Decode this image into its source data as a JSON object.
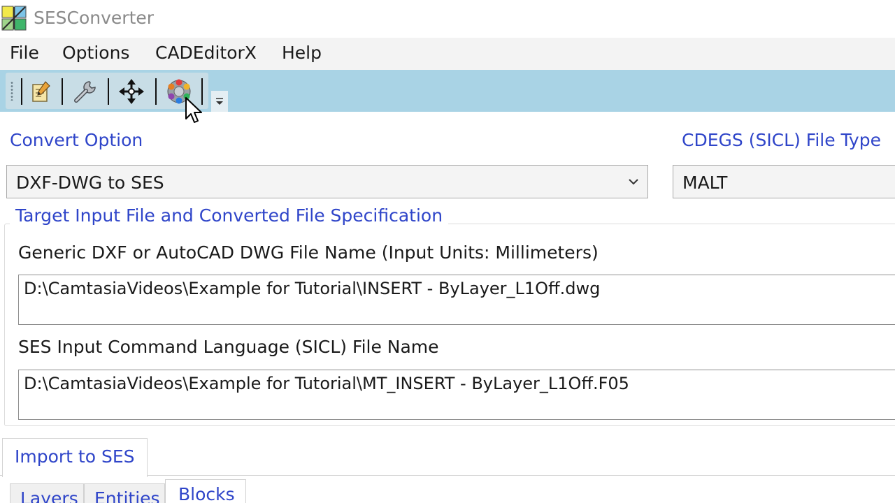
{
  "window": {
    "title": "SESConverter",
    "icon": "app-logo-icon"
  },
  "menu": {
    "items": [
      "File",
      "Options",
      "CADEditorX",
      "Help"
    ]
  },
  "toolbar": {
    "buttons": [
      {
        "icon": "edit-document-icon"
      },
      {
        "icon": "wrench-icon"
      },
      {
        "icon": "move-arrows-icon"
      },
      {
        "icon": "color-wheel-icon"
      }
    ],
    "overflow_icon": "toolbar-overflow-icon"
  },
  "convert_option": {
    "label": "Convert Option",
    "selected": "DXF-DWG to SES"
  },
  "file_type": {
    "label": "CDEGS (SICL) File Type",
    "selected": "MALT"
  },
  "target_group": {
    "title": "Target Input File and Converted File Specification",
    "input_label": "Generic DXF or AutoCAD DWG File Name  (Input Units: Millimeters)",
    "input_value": "D:\\CamtasiaVideos\\Example for Tutorial\\INSERT - ByLayer_L1Off.dwg",
    "output_label": "SES Input Command Language (SICL) File Name",
    "output_value": "D:\\CamtasiaVideos\\Example for Tutorial\\MT_INSERT - ByLayer_L1Off.F05"
  },
  "tabs": {
    "main": "Import to SES",
    "sub": [
      "Layers",
      "Entities",
      "Blocks"
    ],
    "active_sub": "Blocks"
  },
  "colors": {
    "label_blue": "#2f45c9",
    "toolbar_blue": "#a9d3e5",
    "menu_bg": "#f3f3f3"
  }
}
